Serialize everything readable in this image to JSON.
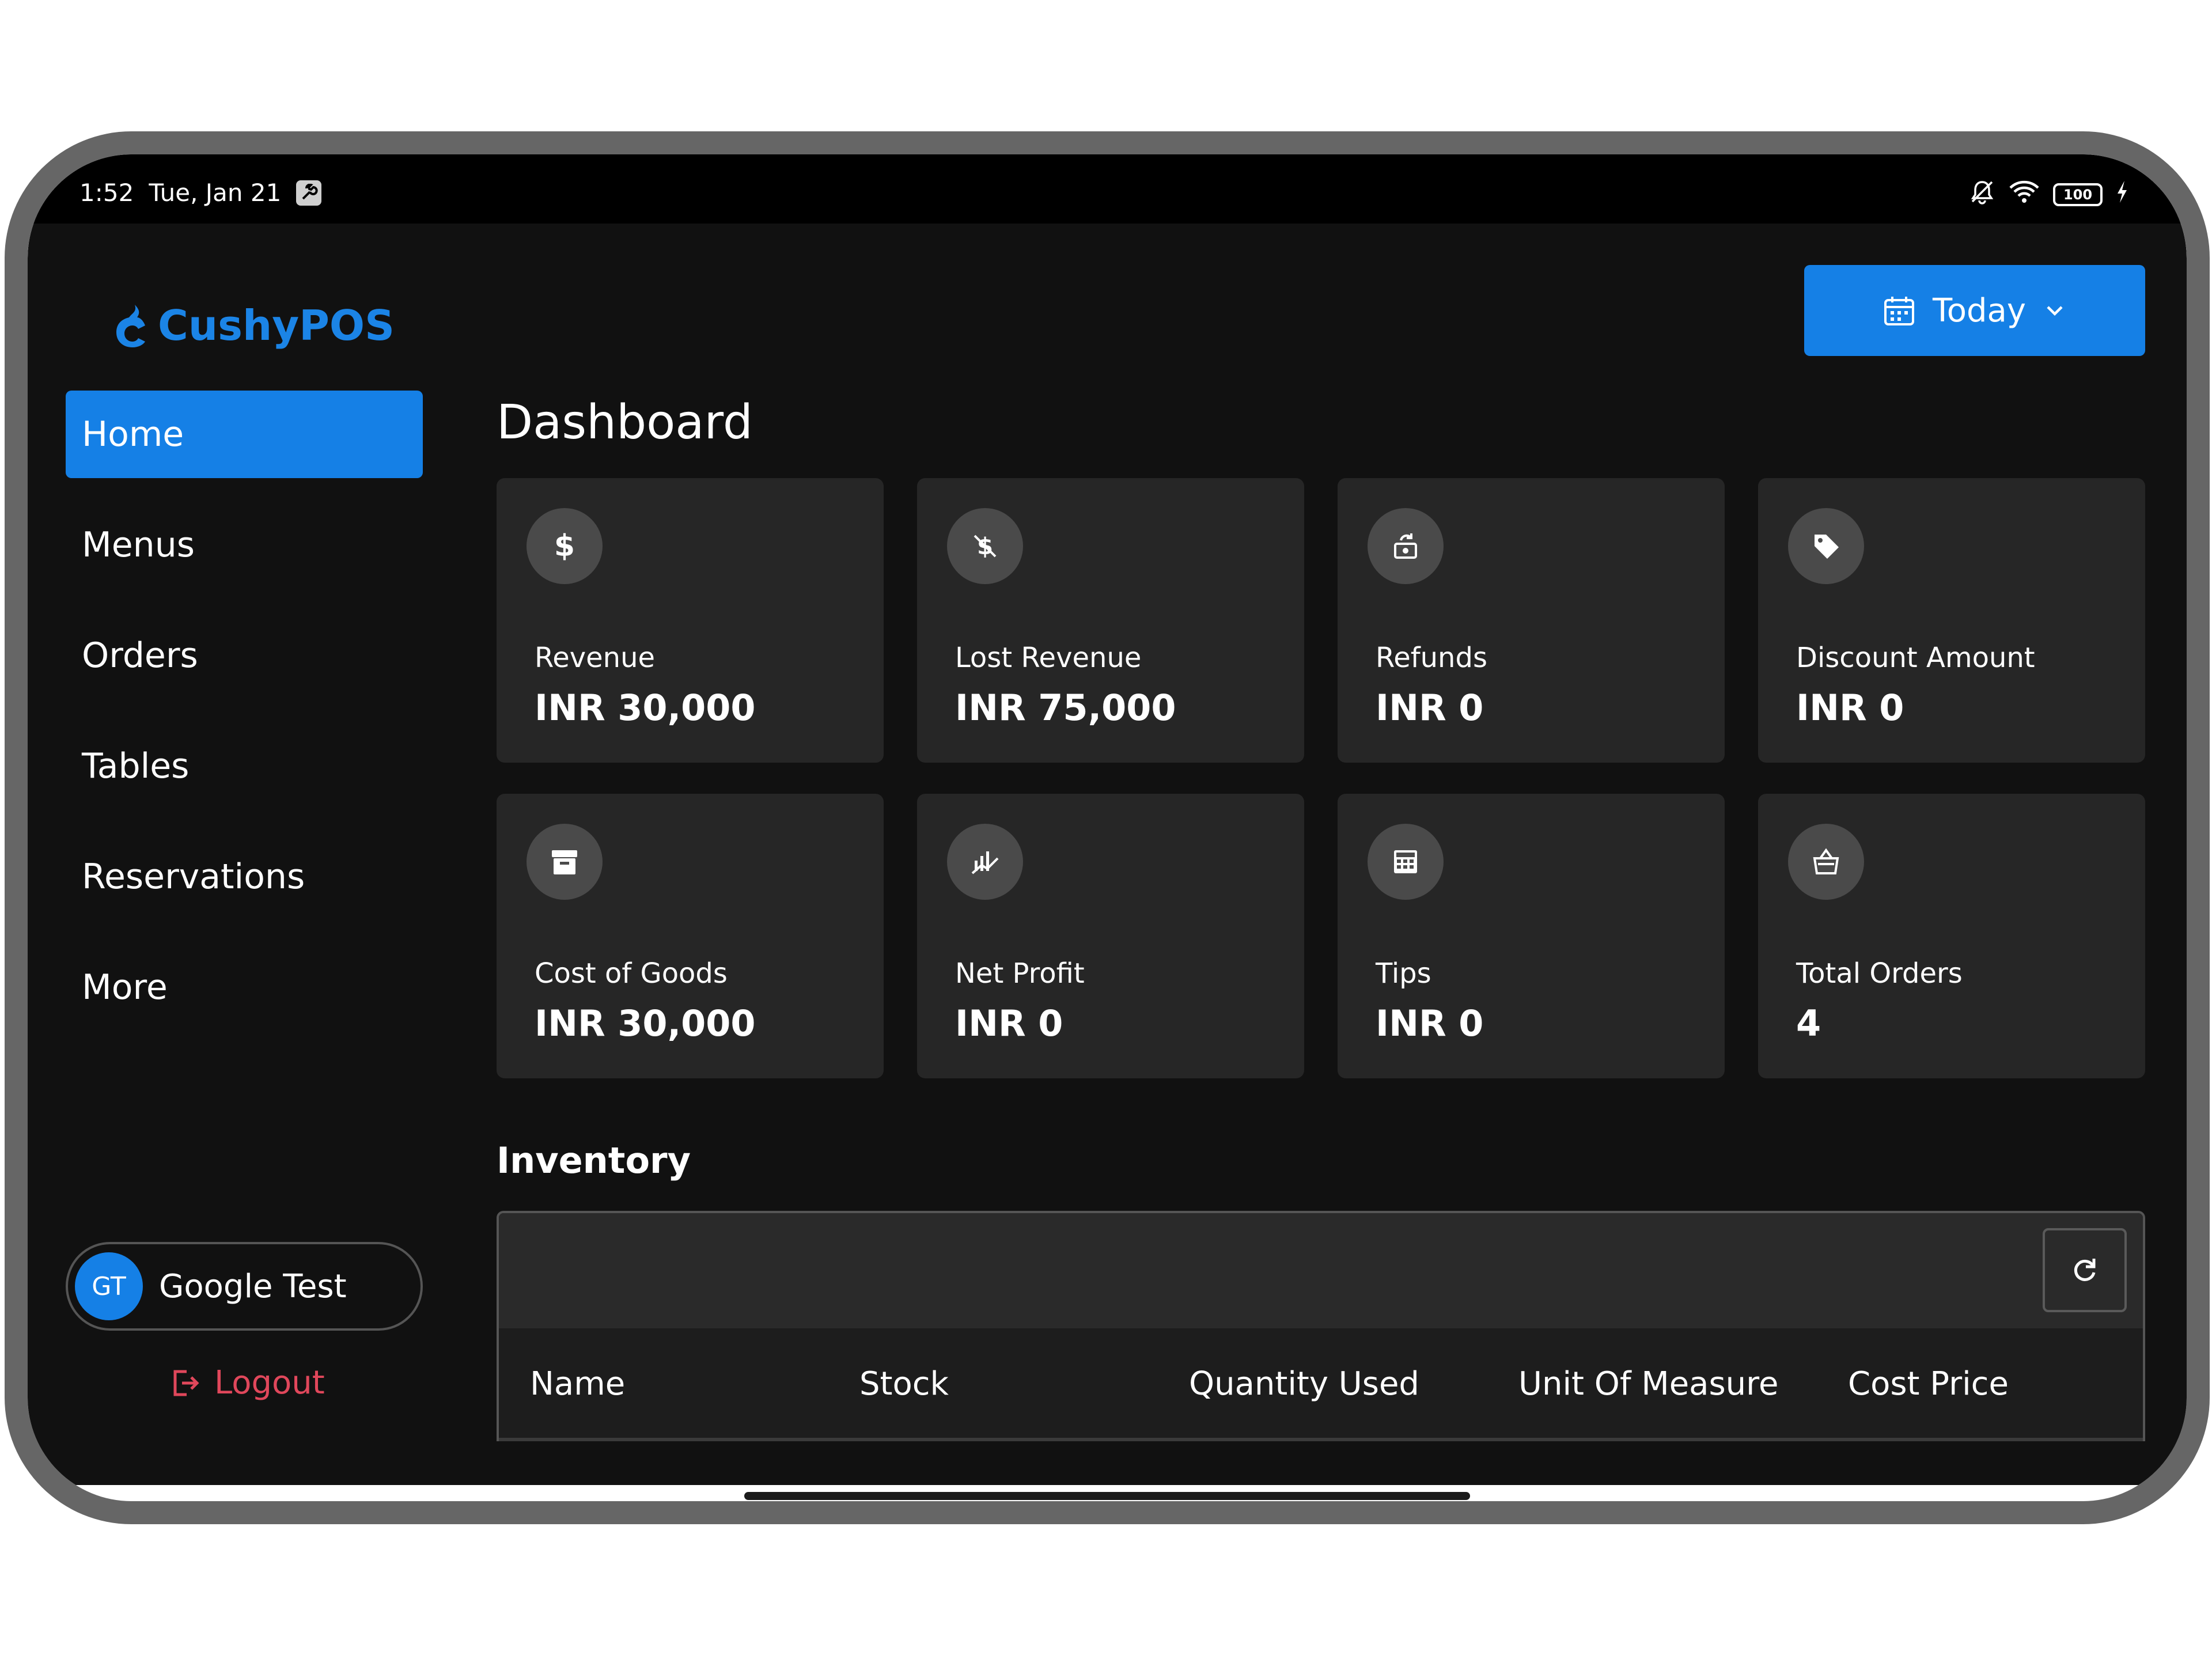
{
  "status_bar": {
    "time": "1:52",
    "date": "Tue, Jan 21",
    "battery": "100"
  },
  "brand": {
    "name": "CushyPOS",
    "accent": "#1580e6"
  },
  "sidebar": {
    "items": [
      {
        "label": "Home",
        "active": true
      },
      {
        "label": "Menus",
        "active": false
      },
      {
        "label": "Orders",
        "active": false
      },
      {
        "label": "Tables",
        "active": false
      },
      {
        "label": "Reservations",
        "active": false
      },
      {
        "label": "More",
        "active": false
      }
    ],
    "user": {
      "initials": "GT",
      "name": "Google Test"
    },
    "logout_label": "Logout"
  },
  "header": {
    "date_filter": "Today"
  },
  "main": {
    "title": "Dashboard",
    "cards": [
      {
        "icon": "dollar-icon",
        "label": "Revenue",
        "value": "INR 30,000"
      },
      {
        "icon": "no-dollar-icon",
        "label": "Lost Revenue",
        "value": "INR 75,000"
      },
      {
        "icon": "refund-icon",
        "label": "Refunds",
        "value": "INR 0"
      },
      {
        "icon": "tag-icon",
        "label": "Discount Amount",
        "value": "INR 0"
      },
      {
        "icon": "archive-icon",
        "label": "Cost of Goods",
        "value": "INR 30,000"
      },
      {
        "icon": "chart-icon",
        "label": "Net Profit",
        "value": "INR 0"
      },
      {
        "icon": "calculator-icon",
        "label": "Tips",
        "value": "INR 0"
      },
      {
        "icon": "basket-icon",
        "label": "Total Orders",
        "value": "4"
      }
    ],
    "inventory": {
      "title": "Inventory",
      "columns": [
        "Name",
        "Stock",
        "Quantity Used",
        "Unit Of Measure",
        "Cost Price"
      ]
    }
  }
}
